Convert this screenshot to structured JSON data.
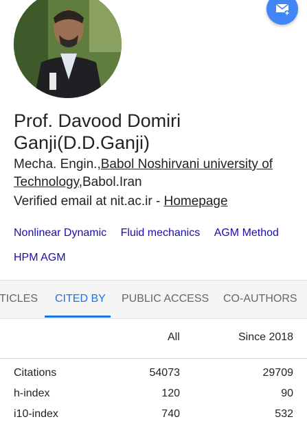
{
  "profile": {
    "name": "Prof. Davood Domiri Ganji(D.D.Ganji)",
    "affiliation_prefix": "Mecha. Engin.,",
    "affiliation_link": "Babol Noshirvani university of Technology",
    "affiliation_suffix": ",Babol.Iran",
    "email_text": "Verified email at nit.ac.ir - ",
    "homepage_label": "Homepage"
  },
  "interests": [
    "Nonlinear Dynamic",
    "Fluid mechanics",
    "AGM Method",
    "HPM AGM"
  ],
  "tabs": {
    "articles": "TICLES",
    "cited_by": "CITED BY",
    "public_access": "PUBLIC ACCESS",
    "co_authors": "CO-AUTHORS"
  },
  "stats": {
    "col_all": "All",
    "col_since": "Since 2018",
    "rows": [
      {
        "label": "Citations",
        "all": "54073",
        "since": "29709"
      },
      {
        "label": "h-index",
        "all": "120",
        "since": "90"
      },
      {
        "label": "i10-index",
        "all": "740",
        "since": "532"
      }
    ]
  },
  "colors": {
    "accent": "#1a73e8",
    "link": "#1a0dab",
    "fab": "#4285f4"
  },
  "icons": {
    "fab": "email-add-icon"
  }
}
